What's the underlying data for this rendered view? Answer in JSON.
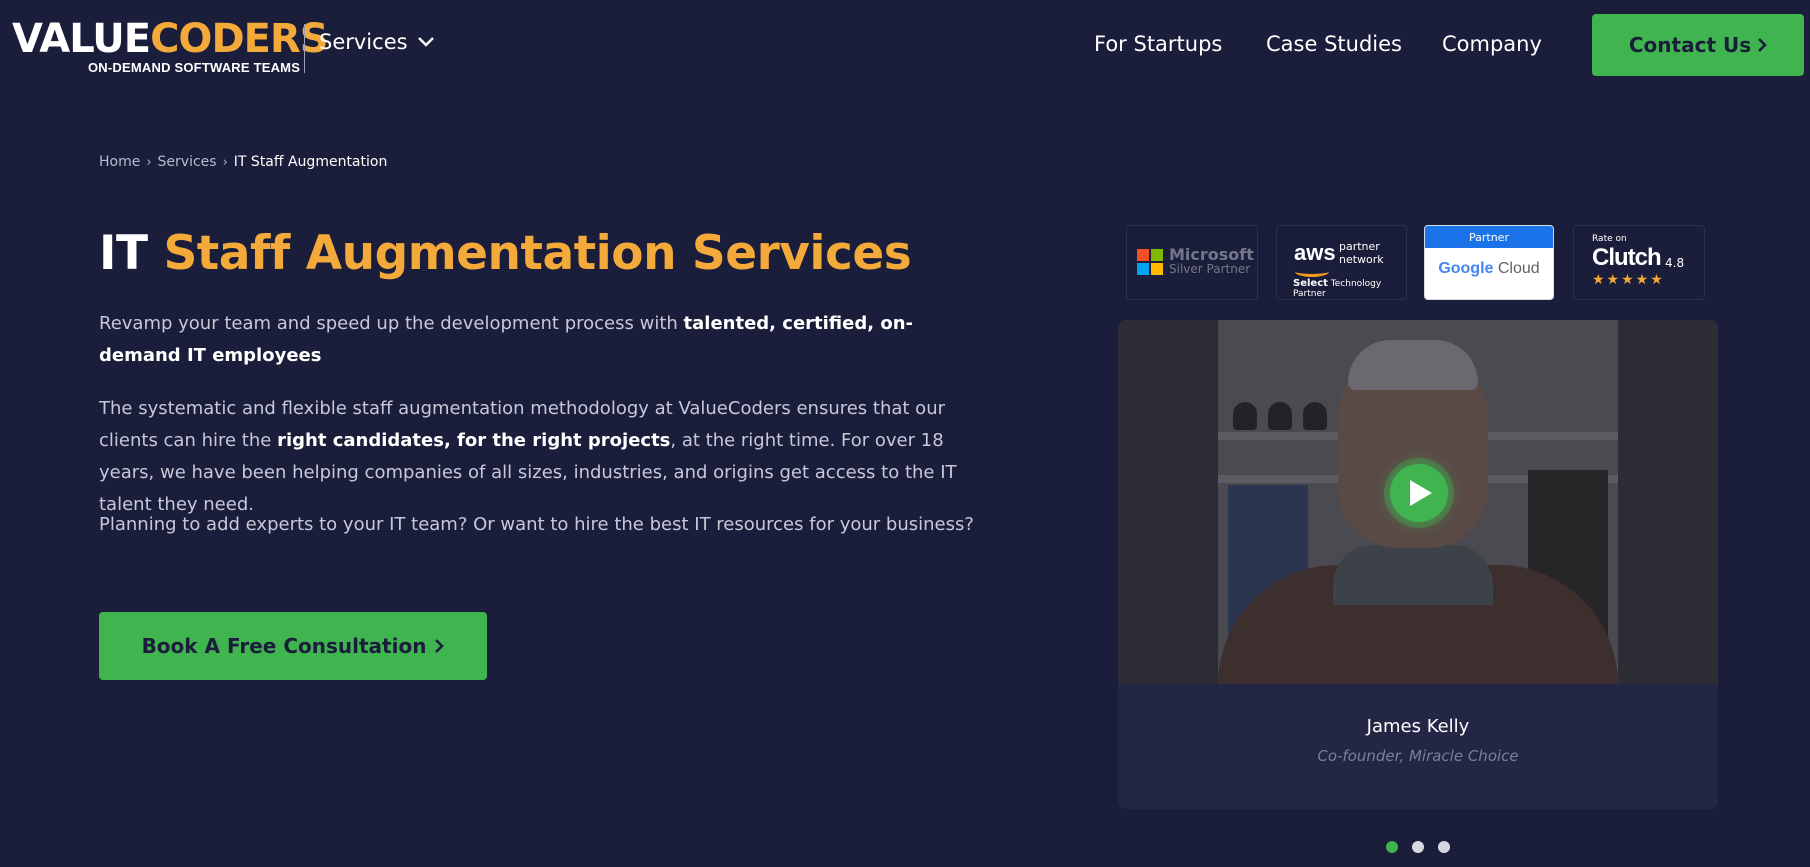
{
  "header": {
    "logo": {
      "part1": "VALUE",
      "part2": "CODERS",
      "tagline": "ON-DEMAND SOFTWARE TEAMS"
    },
    "services_label": "Services",
    "nav": [
      "For Startups",
      "Case Studies",
      "Company"
    ],
    "contact_label": "Contact Us"
  },
  "breadcrumb": {
    "home": "Home",
    "services": "Services",
    "current": "IT Staff Augmentation"
  },
  "hero": {
    "title_plain": "IT",
    "title_accent": "Staff Augmentation Services",
    "p1_a": "Revamp your team and speed up the development process with ",
    "p1_b": "talented, certified, on-demand IT employees",
    "p2_a": "The systematic and flexible staff augmentation methodology at ValueCoders ensures that our clients can hire the ",
    "p2_b": "right candidates, for the right projects",
    "p2_c": ", at the right time. For over 18 years, we have been helping companies of all sizes, industries, and origins get access to the IT talent they need.",
    "p3": "Planning to add experts to your IT team? Or want to hire the best IT resources for your business?",
    "cta_label": "Book A Free Consultation"
  },
  "badges": {
    "microsoft": {
      "name": "Microsoft",
      "tier": "Silver Partner"
    },
    "aws": {
      "word": "aws",
      "line1": "partner",
      "line2": "network",
      "select": "Select",
      "tier": "Technology Partner"
    },
    "google": {
      "strip": "Partner",
      "word": "Google",
      "product": "Cloud"
    },
    "clutch": {
      "rate": "Rate on",
      "word": "Clutch",
      "score": "4.8",
      "stars": "★★★★★"
    }
  },
  "testimonial": {
    "name": "James Kelly",
    "role": "Co-founder, Miracle Choice"
  },
  "carousel": {
    "count": 3,
    "active_index": 0
  },
  "colors": {
    "background": "#1b1e3a",
    "accent": "#f4a93b",
    "green": "#3fb44f"
  }
}
